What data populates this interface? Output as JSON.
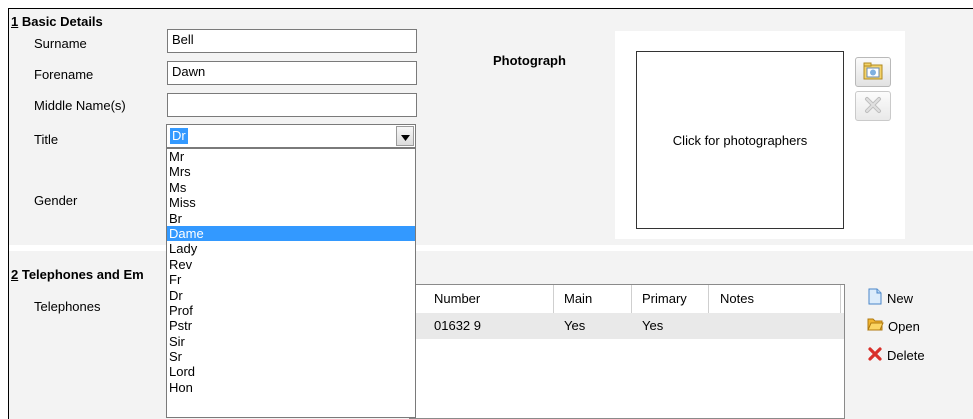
{
  "basic": {
    "section_number": "1",
    "section_title": " Basic Details",
    "surname_label": "Surname",
    "surname_value": "Bell",
    "forename_label": "Forename",
    "forename_value": "Dawn",
    "middle_label": "Middle Name(s)",
    "middle_value": "",
    "title_label": "Title",
    "title_value": "Dr",
    "gender_label": "Gender",
    "photograph_label": "Photograph",
    "photo_placeholder": "Click for photographers"
  },
  "title_options": [
    "Mr",
    "Mrs",
    "Ms",
    "Miss",
    "Br",
    "Dame",
    "Lady",
    "Rev",
    "Fr",
    "Dr",
    "Prof",
    "Pstr",
    "Sir",
    "Sr",
    "Lord",
    "Hon"
  ],
  "title_highlighted": "Dame",
  "telephones": {
    "section_number": "2",
    "section_title": " Telephones and Em",
    "label": "Telephones",
    "columns": [
      "Number",
      "Main",
      "Primary",
      "Notes"
    ],
    "rows": [
      {
        "number": "01632 9",
        "main": "Yes",
        "primary": "Yes",
        "notes": ""
      }
    ],
    "actions": {
      "new": "New",
      "open": "Open",
      "delete": "Delete"
    }
  },
  "colors": {
    "selection": "#3399ff",
    "panel": "#f3f3f3"
  },
  "icons": {
    "photo_load": "folder-photo-icon",
    "photo_clear": "clear-x-icon",
    "new": "new-document-icon",
    "open": "open-folder-icon",
    "delete": "delete-x-icon"
  }
}
